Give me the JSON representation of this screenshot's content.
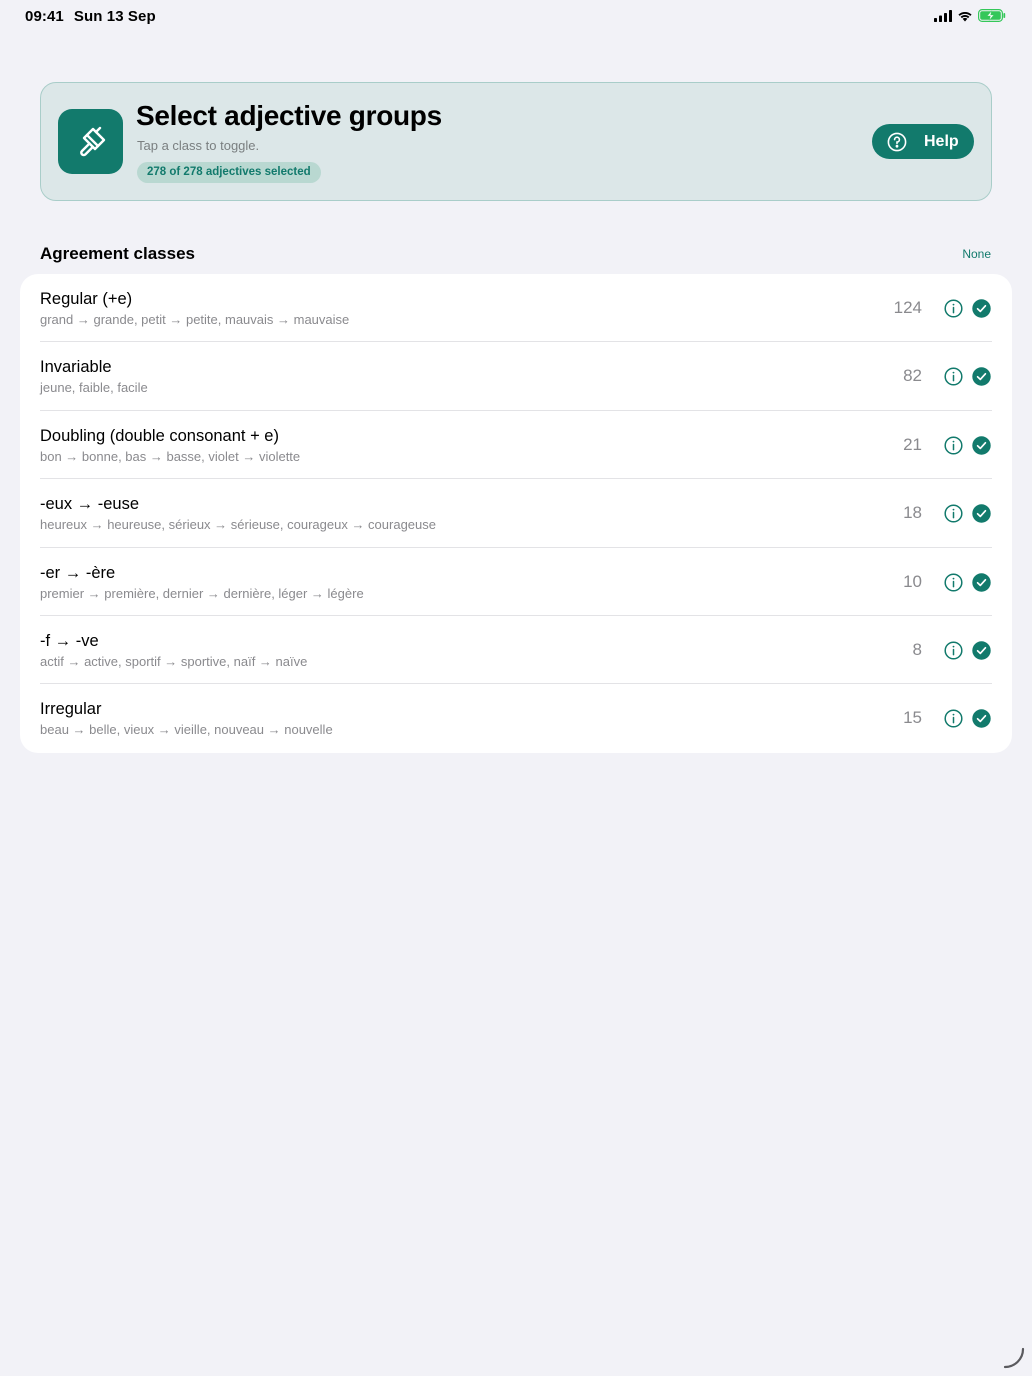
{
  "status": {
    "time": "09:41",
    "date": "Sun 13 Sep"
  },
  "header": {
    "title": "Select adjective groups",
    "subtitle": "Tap a class to toggle.",
    "badge": "278 of 278 adjectives selected",
    "help_label": "Help",
    "app_icon": "paintbrush-icon"
  },
  "section": {
    "title": "Agreement classes",
    "none_label": "None"
  },
  "classes": [
    {
      "title": "Regular (+e)",
      "examples": "grand → grande, petit → petite, mauvais → mauvaise",
      "count": "124",
      "selected": true
    },
    {
      "title": "Invariable",
      "examples": "jeune, faible, facile",
      "count": "82",
      "selected": true
    },
    {
      "title": "Doubling (double consonant + e)",
      "examples": "bon → bonne, bas → basse, violet → violette",
      "count": "21",
      "selected": true
    },
    {
      "title": "-eux → -euse",
      "examples": "heureux → heureuse, sérieux → sérieuse, courageux → courageuse",
      "count": "18",
      "selected": true
    },
    {
      "title": "-er → -ère",
      "examples": "premier → première, dernier → dernière, léger → légère",
      "count": "10",
      "selected": true
    },
    {
      "title": "-f → -ve",
      "examples": "actif → active, sportif → sportive, naïf → naïve",
      "count": "8",
      "selected": true
    },
    {
      "title": "Irregular",
      "examples": "beau → belle, vieux → vieille, nouveau → nouvelle",
      "count": "15",
      "selected": true
    }
  ],
  "colors": {
    "accent": "#127a6c",
    "header_bg": "#dce7e8",
    "background": "#f2f2f7"
  }
}
